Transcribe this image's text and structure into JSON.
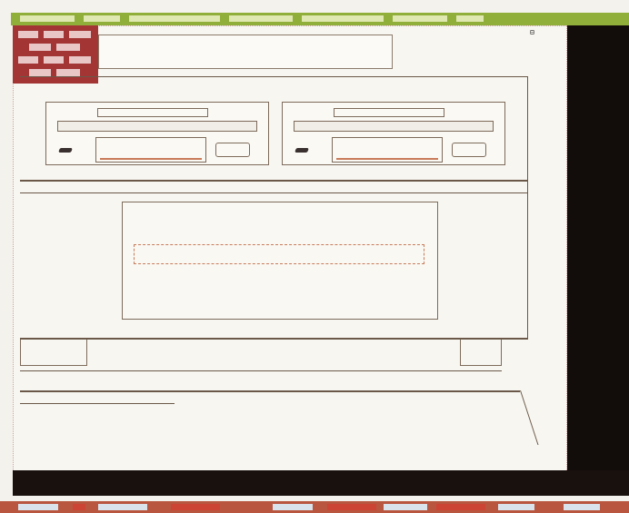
{
  "window": {
    "title": "",
    "logo_label": "",
    "resize_icon": "⊟"
  },
  "console": {
    "line1": "",
    "line2": ""
  },
  "taskbar": {
    "items": [
      "",
      "",
      "",
      "",
      "",
      "",
      "",
      "",
      "",
      ""
    ]
  },
  "colors": {
    "titlebar": "#8fae3a",
    "logo": "#a33535",
    "taskbar": "#b8563f",
    "console_bg": "#18110e"
  },
  "icons": {
    "logo": "brick-logo-icon",
    "resize": "window-resize-icon",
    "led": "drive-led-icon"
  }
}
